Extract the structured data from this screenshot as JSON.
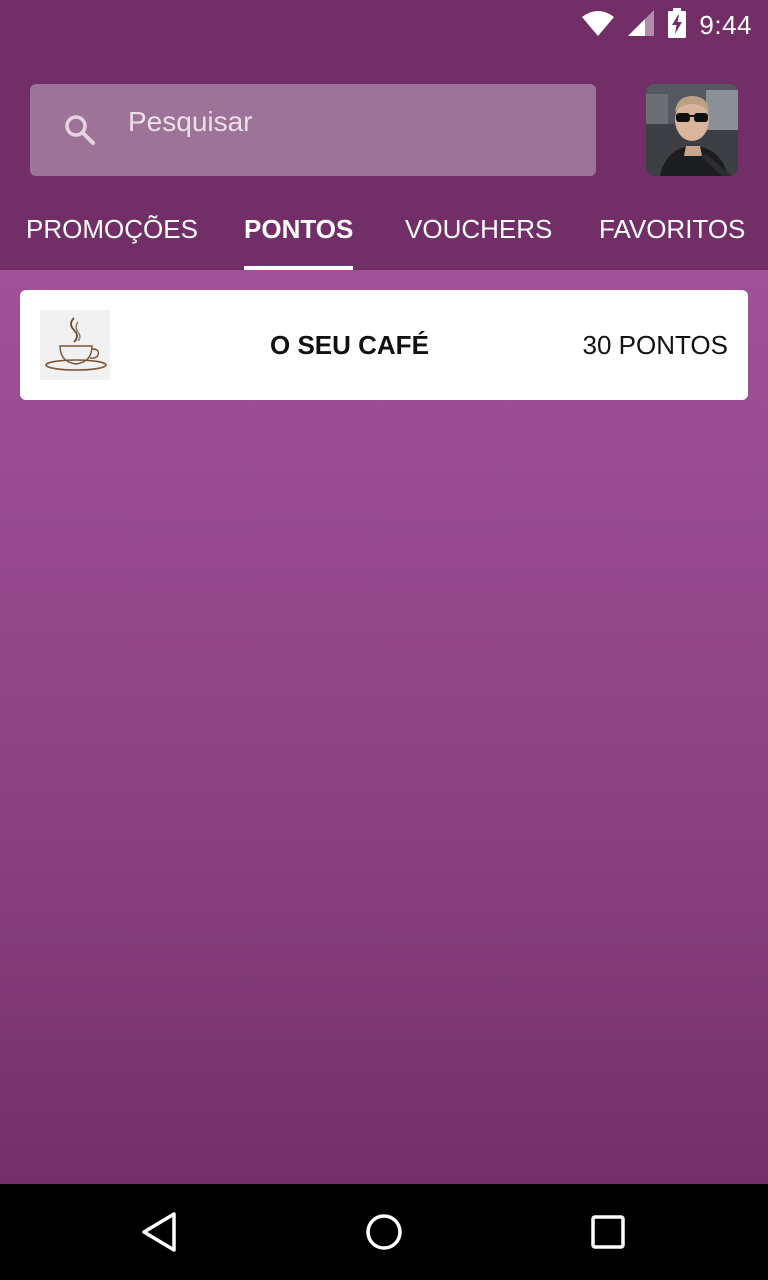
{
  "status_bar": {
    "time": "9:44",
    "icons": [
      "wifi-icon",
      "cell-signal-icon",
      "battery-charging-icon"
    ]
  },
  "search": {
    "placeholder": "Pesquisar",
    "icon": "search-icon"
  },
  "profile": {
    "avatar": "avatar"
  },
  "tabs": [
    {
      "label": "PROMOÇÕES",
      "active": false
    },
    {
      "label": "PONTOS",
      "active": true
    },
    {
      "label": "VOUCHERS",
      "active": false
    },
    {
      "label": "FAVORITOS",
      "active": false
    }
  ],
  "points_list": [
    {
      "name": "O SEU CAFÉ",
      "points": "30 PONTOS",
      "thumbnail": "coffee-cup-icon"
    }
  ],
  "nav_bar": {
    "icons": [
      "back-icon",
      "home-icon",
      "recents-icon"
    ]
  },
  "colors": {
    "app_bar": "#722f67",
    "content_gradient_top": "#a95aa1",
    "content_gradient_bottom": "#742f68",
    "search_box": "#9d7498"
  }
}
